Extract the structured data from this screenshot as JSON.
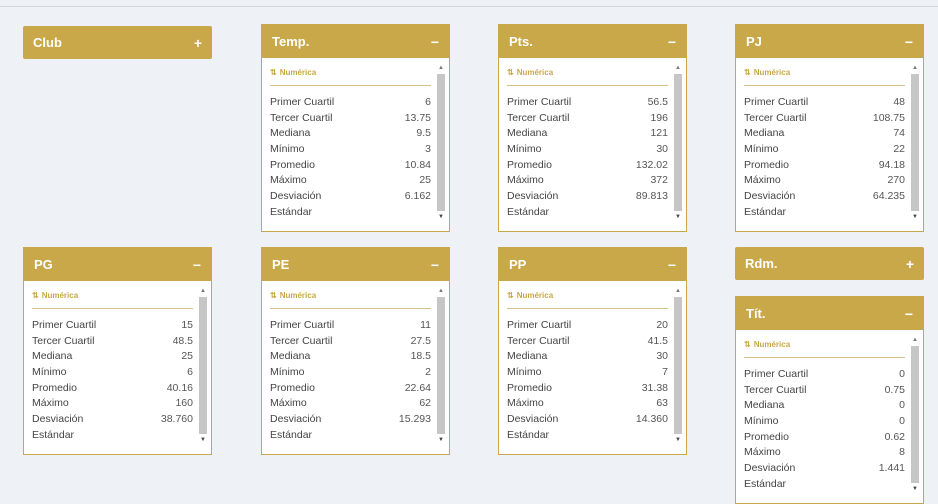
{
  "labels": {
    "tag": "Numérica",
    "rows": [
      "Primer Cuartil",
      "Tercer Cuartil",
      "Mediana",
      "Mínimo",
      "Promedio",
      "Máximo",
      "Desviación",
      "Estándar"
    ]
  },
  "colors": {
    "accent": "#c9a84a",
    "background": "#eef1f6"
  },
  "cards": [
    {
      "title": "Club",
      "toggle": "+"
    },
    {
      "title": "Temp.",
      "toggle": "−",
      "values": [
        "6",
        "13.75",
        "9.5",
        "3",
        "10.84",
        "25",
        "6.162",
        ""
      ]
    },
    {
      "title": "Pts.",
      "toggle": "−",
      "values": [
        "56.5",
        "196",
        "121",
        "30",
        "132.02",
        "372",
        "89.813",
        ""
      ]
    },
    {
      "title": "PJ",
      "toggle": "−",
      "values": [
        "48",
        "108.75",
        "74",
        "22",
        "94.18",
        "270",
        "64.235",
        ""
      ]
    },
    {
      "title": "PG",
      "toggle": "−",
      "values": [
        "15",
        "48.5",
        "25",
        "6",
        "40.16",
        "160",
        "38.760",
        ""
      ]
    },
    {
      "title": "PE",
      "toggle": "−",
      "values": [
        "11",
        "27.5",
        "18.5",
        "2",
        "22.64",
        "62",
        "15.293",
        ""
      ]
    },
    {
      "title": "PP",
      "toggle": "−",
      "values": [
        "20",
        "41.5",
        "30",
        "7",
        "31.38",
        "63",
        "14.360",
        ""
      ]
    },
    {
      "title": "Rdm.",
      "toggle": "+"
    },
    {
      "title": "Tít.",
      "toggle": "−",
      "values": [
        "0",
        "0.75",
        "0",
        "0",
        "0.62",
        "8",
        "1.441",
        ""
      ]
    }
  ]
}
